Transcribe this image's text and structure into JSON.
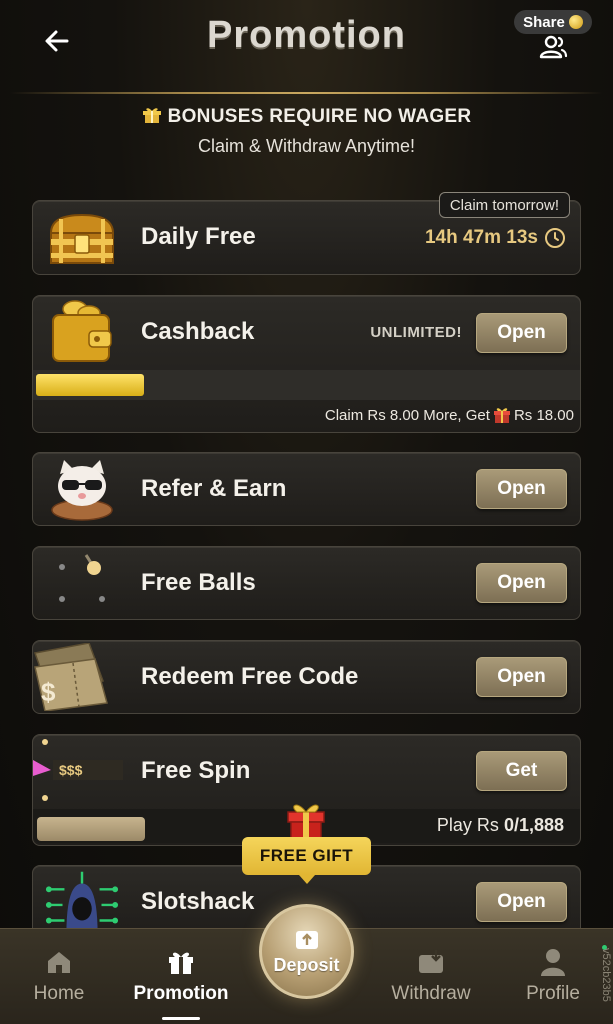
{
  "header": {
    "title": "Promotion",
    "share_label": "Share"
  },
  "bonus": {
    "headline": "BONUSES REQUIRE NO WAGER",
    "subline": "Claim & Withdraw Anytime!"
  },
  "cards": {
    "daily_free": {
      "title": "Daily Free",
      "badge": "Claim tomorrow!",
      "timer": "14h 47m 13s"
    },
    "cashback": {
      "title": "Cashback",
      "tag": "UNLIMITED!",
      "button": "Open",
      "progress_fraction": 0.2,
      "note_prefix": "Claim Rs 8.00 More, Get",
      "note_reward": "Rs 18.00"
    },
    "refer": {
      "title": "Refer & Earn",
      "button": "Open"
    },
    "free_balls": {
      "title": "Free Balls",
      "button": "Open"
    },
    "redeem": {
      "title": "Redeem Free Code",
      "button": "Open"
    },
    "free_spin": {
      "title": "Free Spin",
      "button": "Get",
      "ticket_text": "$$$",
      "note_prefix": "Play Rs ",
      "note_value": "0/1,888"
    },
    "slotshack": {
      "title": "Slotshack",
      "button": "Open"
    }
  },
  "free_gift_label": "FREE GIFT",
  "nav": {
    "home": "Home",
    "promotion": "Promotion",
    "deposit": "Deposit",
    "withdraw": "Withdraw",
    "profile": "Profile"
  },
  "version": "v52cb23b5",
  "colors": {
    "accent_gold": "#e7c980",
    "button_bg": "#9a8b6a",
    "progress_gold": "#f0c83a",
    "free_gift_bg": "#f0c84a"
  }
}
